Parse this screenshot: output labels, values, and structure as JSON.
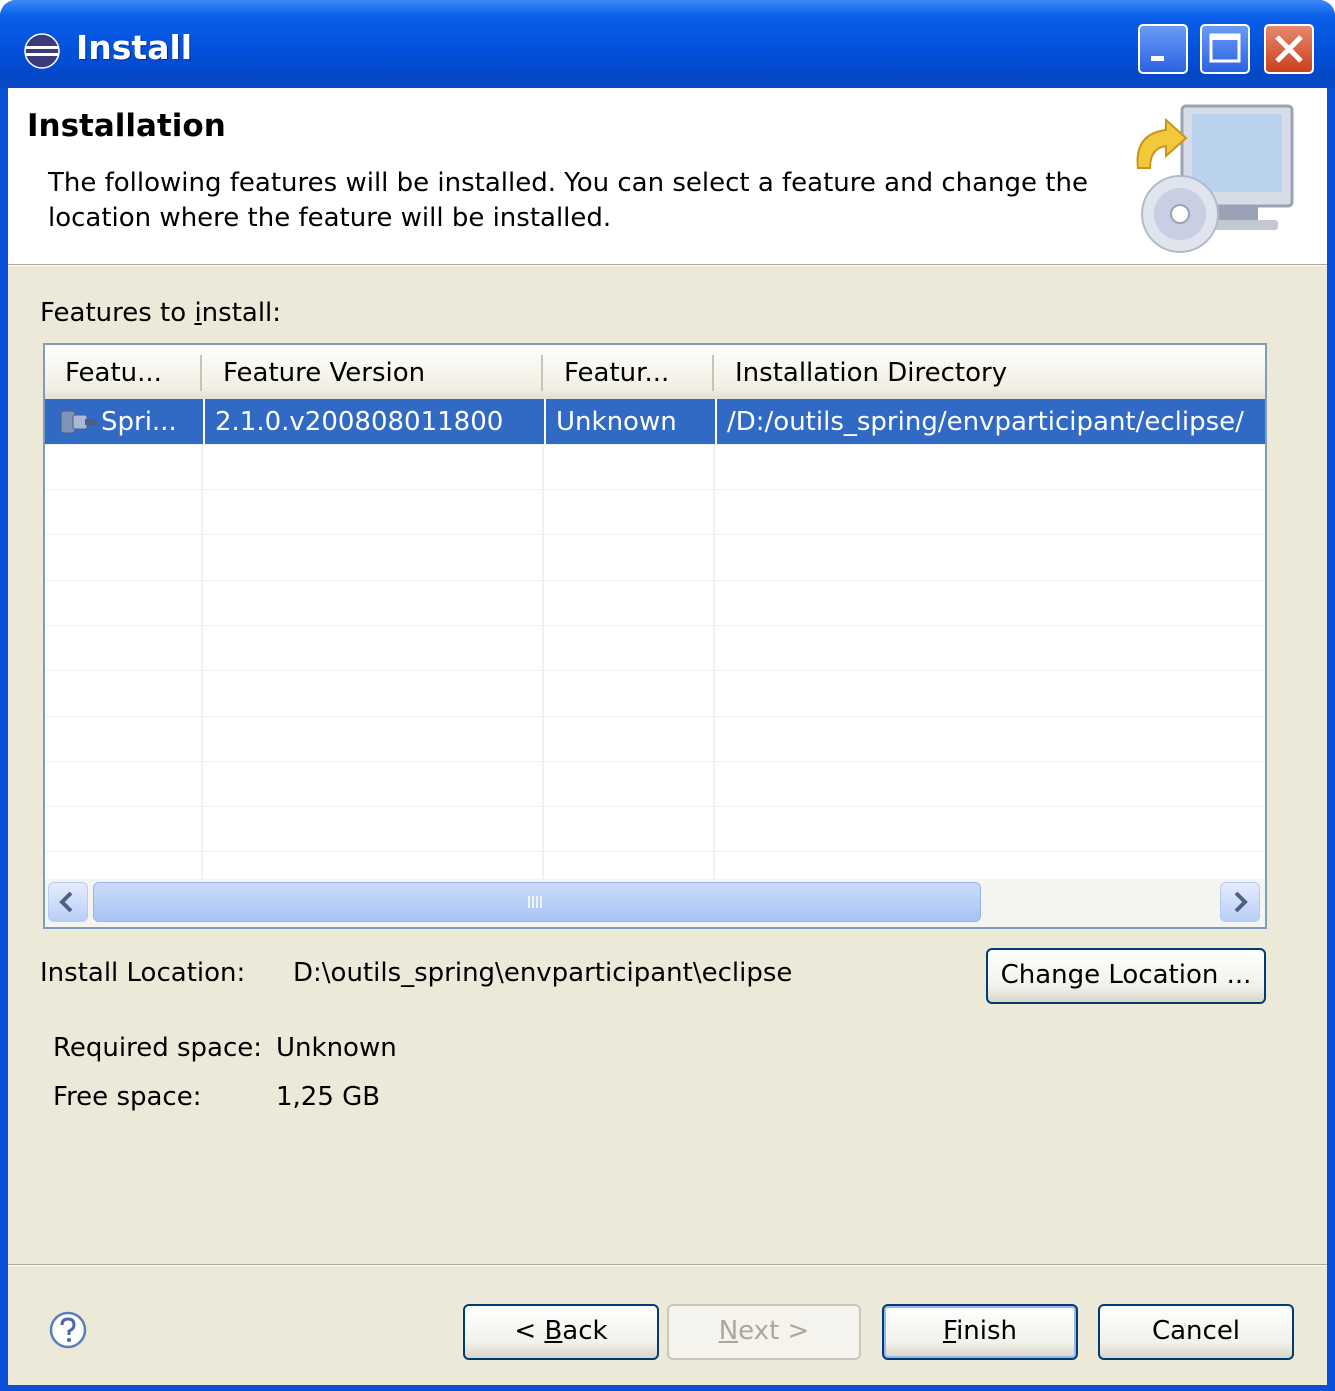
{
  "window": {
    "title": "Install",
    "buttons": [
      "minimize-icon",
      "maximize-icon",
      "close-icon"
    ]
  },
  "banner": {
    "title": "Installation",
    "description": "The following features will be installed. You can select a feature and change the location where the feature will be installed."
  },
  "features": {
    "label_pre": "Features to ",
    "label_mnemonic": "i",
    "label_post": "nstall:",
    "columns": [
      "Featu...",
      "Feature Version",
      "Featur...",
      "Installation Directory"
    ],
    "rows": [
      {
        "name": "Spri...",
        "version": "2.1.0.v200808011800",
        "size": "Unknown",
        "directory": "/D:/outils_spring/envparticipant/eclipse/",
        "selected": true
      }
    ]
  },
  "install_location": {
    "label": "Install Location:",
    "value": "D:\\outils_spring\\envparticipant\\eclipse",
    "change_button": "Change Location ..."
  },
  "space": {
    "required_label": "Required space:",
    "required_value": "Unknown",
    "free_label": "Free space:",
    "free_value": "1,25 GB"
  },
  "footer": {
    "back_pre": "< ",
    "back_mnemonic": "B",
    "back_post": "ack",
    "next_mnemonic": "N",
    "next_post": "ext >",
    "finish_mnemonic": "F",
    "finish_post": "inish",
    "cancel": "Cancel"
  },
  "colors": {
    "titlebar": "#0551dc",
    "selection": "#316ac5",
    "dialog_bg": "#ece9d8"
  }
}
